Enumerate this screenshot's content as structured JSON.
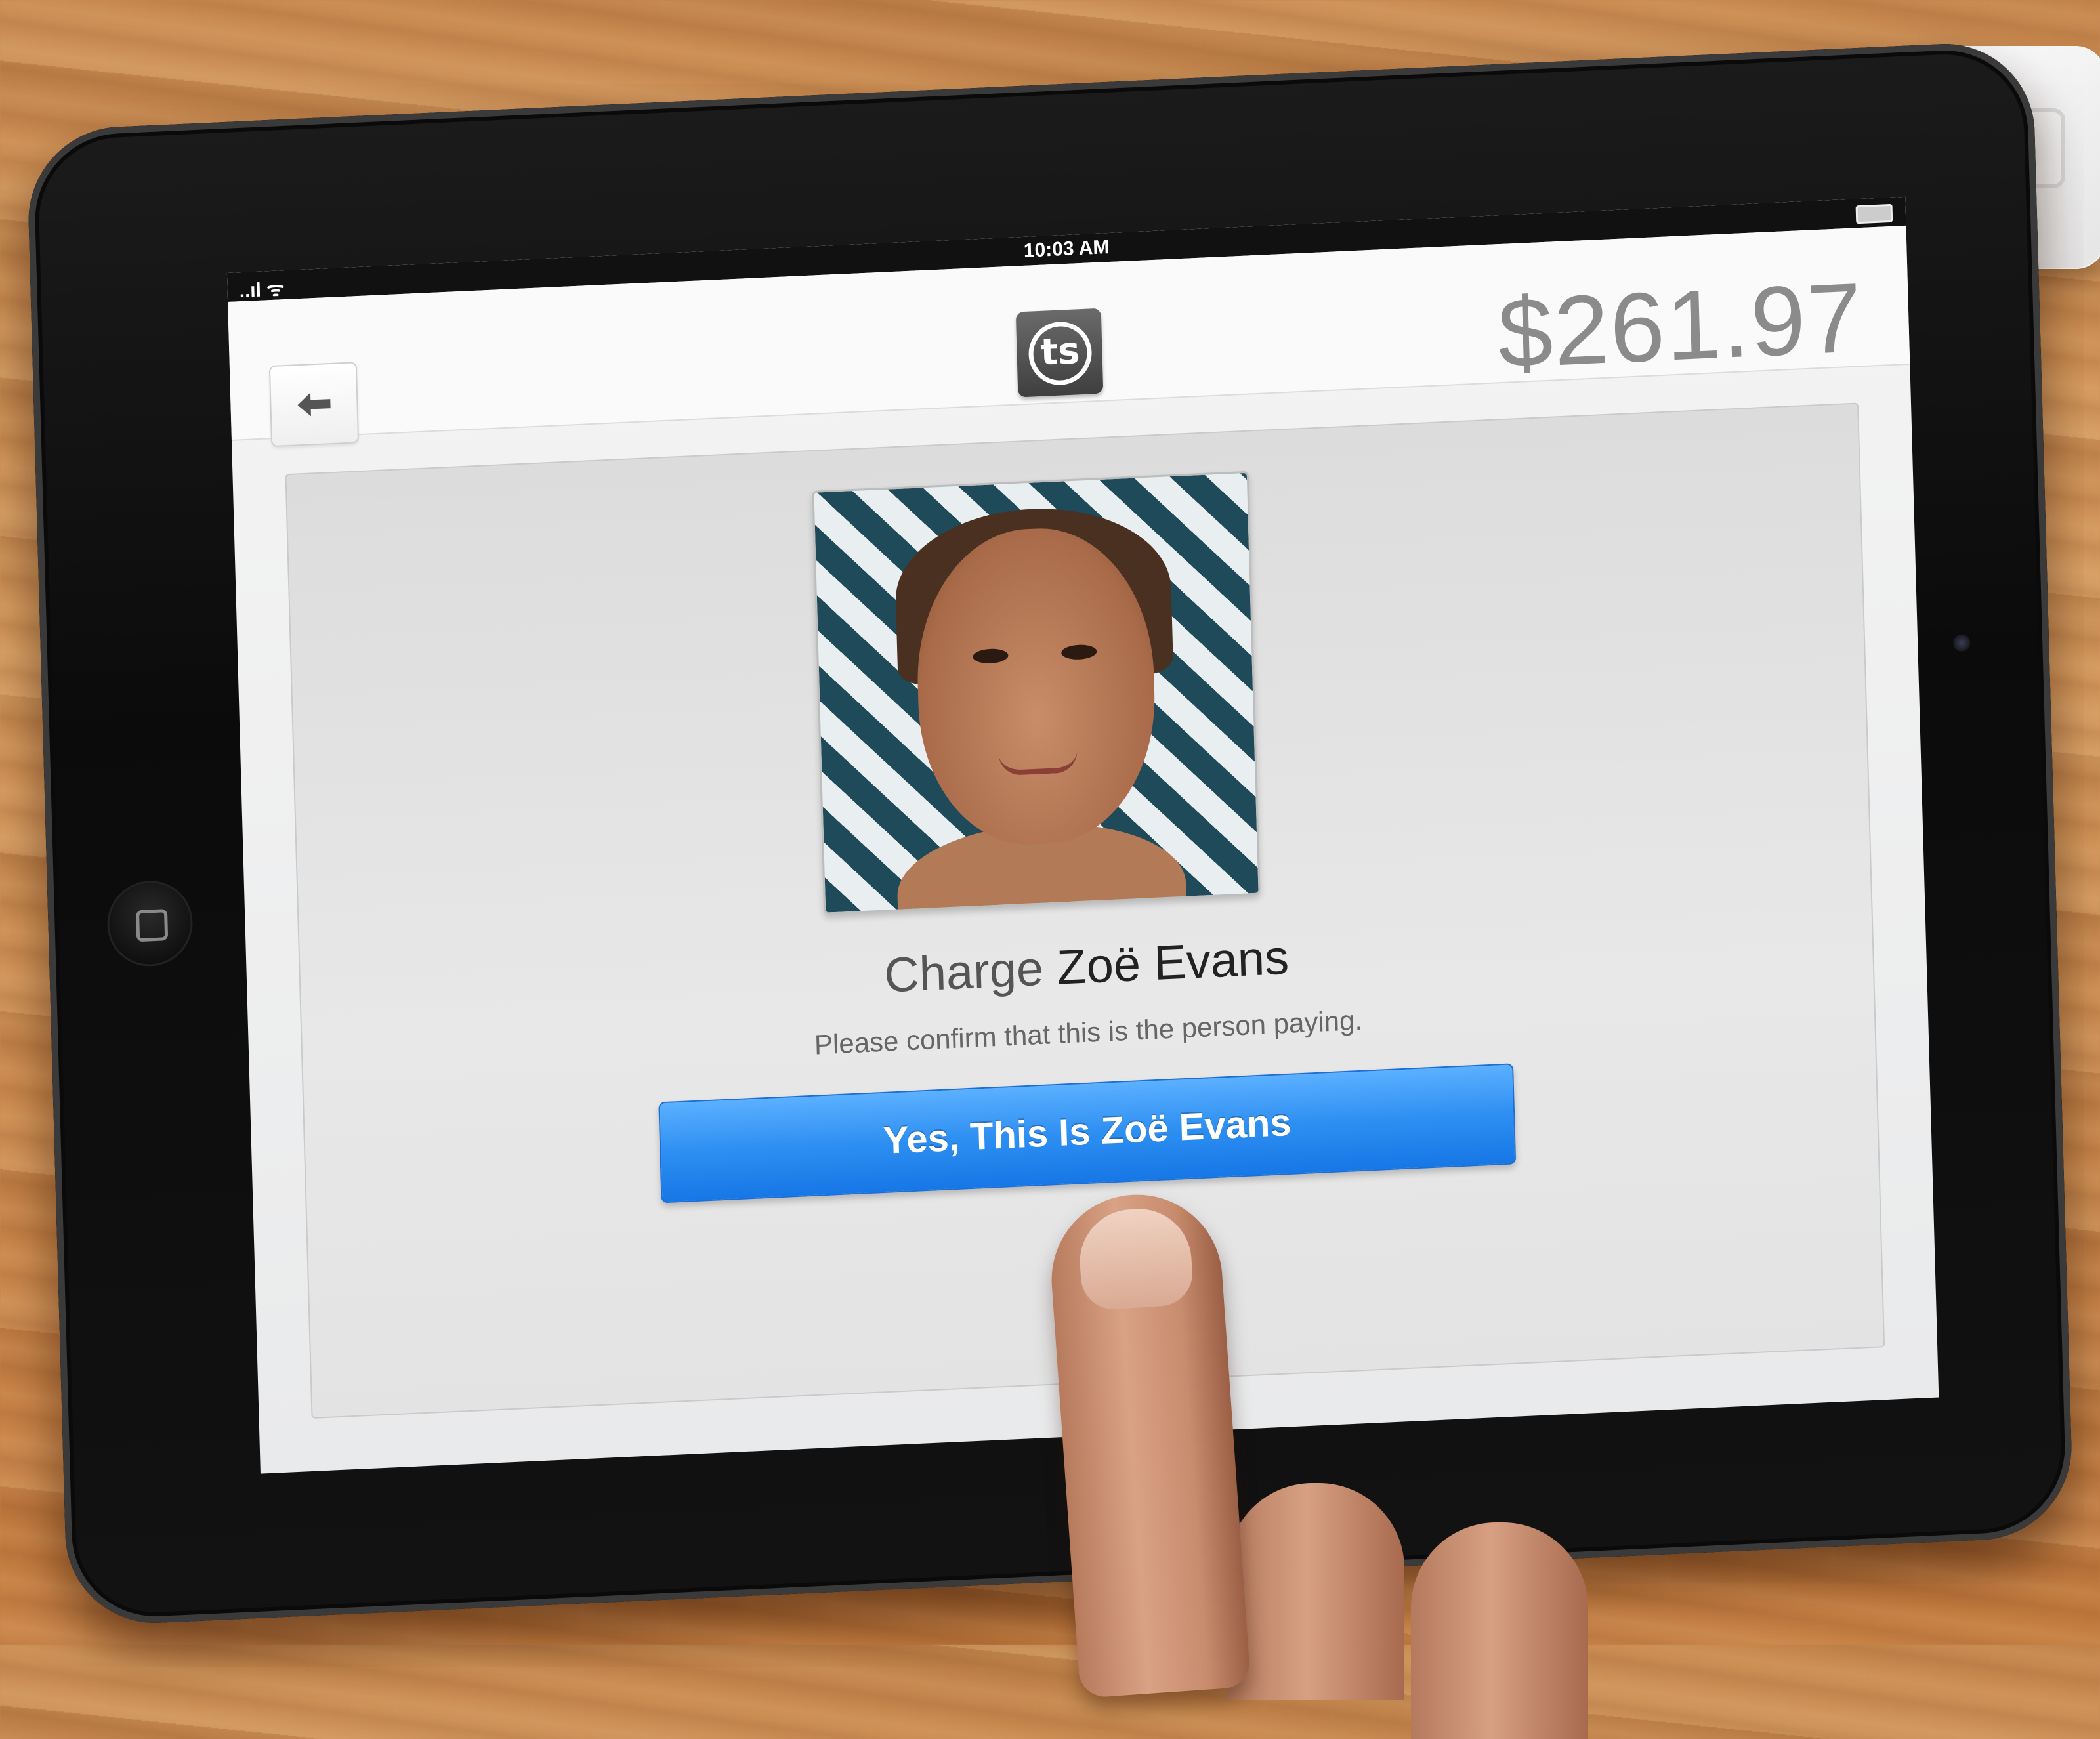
{
  "status_bar": {
    "time": "10:03 AM",
    "signal": "..ıl ᯤ"
  },
  "header": {
    "amount": "$261.97",
    "logo_text": "ts"
  },
  "main": {
    "charge_prefix": "Charge",
    "customer_name": "Zoë Evans",
    "confirm_text": "Please confirm that this is the person paying.",
    "confirm_button_label": "Yes, This Is Zoë Evans"
  },
  "icons": [
    "back-arrow-icon",
    "logo-icon",
    "signal-icon",
    "battery-icon",
    "home-button-icon"
  ],
  "colors": {
    "accent": "#2e8ff2",
    "amount_text": "#8b8b8b"
  }
}
